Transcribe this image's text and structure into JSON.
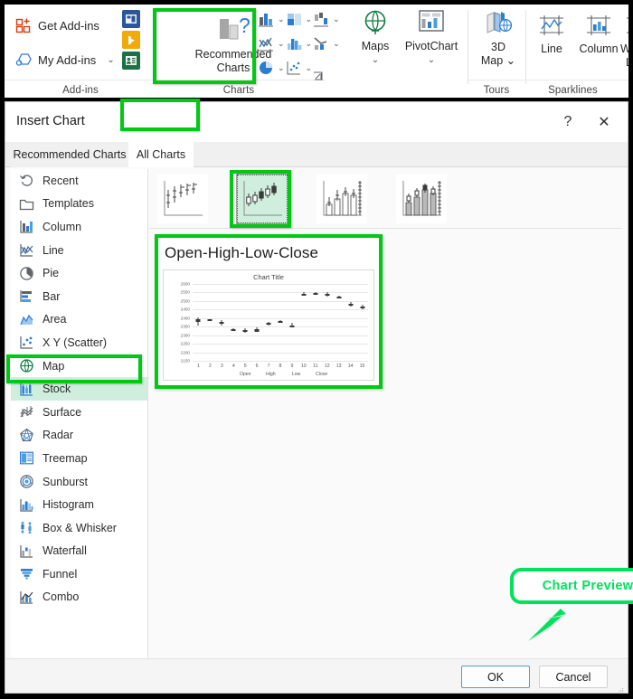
{
  "ribbon": {
    "groups": [
      {
        "name": "Add-ins",
        "caption": "Add-ins"
      },
      {
        "name": "Charts",
        "caption": "Charts"
      },
      {
        "name": "Tours",
        "caption": "Tours"
      },
      {
        "name": "Sparklines",
        "caption": "Sparklines"
      }
    ],
    "addins": {
      "get_addins": "Get Add-ins",
      "my_addins": "My Add-ins",
      "caret": "⌄"
    },
    "recommended_charts": {
      "line1": "Recommended",
      "line2": "Charts"
    },
    "maps": {
      "label": "Maps",
      "caret": "⌄"
    },
    "pivotchart": {
      "label": "PivotChart",
      "caret": "⌄"
    },
    "map3d": {
      "line1": "3D",
      "line2": "Map ⌄"
    },
    "sparklines": [
      {
        "label": "Line"
      },
      {
        "label": "Column"
      },
      {
        "line1": "W",
        "line2": "Lo"
      }
    ],
    "chart_dropdowns": [
      "column-chart-icon",
      "waterfall-chart-icon",
      "stock-chart-icon",
      "line-chart-icon",
      "histogram-chart-icon",
      "combo-chart-icon",
      "pie-chart-icon",
      "scatter-chart-icon"
    ],
    "caret": "⌄"
  },
  "dialog": {
    "title": "Insert Chart",
    "help_glyph": "?",
    "close_glyph": "✕",
    "tabs": [
      {
        "label": "Recommended Charts",
        "selected": false
      },
      {
        "label": "All Charts",
        "selected": true
      }
    ],
    "type_list": [
      {
        "label": "Recent",
        "icon": "recent-icon",
        "selected": false
      },
      {
        "label": "Templates",
        "icon": "templates-icon",
        "selected": false
      },
      {
        "label": "Column",
        "icon": "column-icon",
        "selected": false
      },
      {
        "label": "Line",
        "icon": "line-icon",
        "selected": false
      },
      {
        "label": "Pie",
        "icon": "pie-icon",
        "selected": false
      },
      {
        "label": "Bar",
        "icon": "bar-icon",
        "selected": false
      },
      {
        "label": "Area",
        "icon": "area-icon",
        "selected": false
      },
      {
        "label": "X Y (Scatter)",
        "icon": "scatter-icon",
        "selected": false
      },
      {
        "label": "Map",
        "icon": "map-icon",
        "selected": false
      },
      {
        "label": "Stock",
        "icon": "stock-icon",
        "selected": true
      },
      {
        "label": "Surface",
        "icon": "surface-icon",
        "selected": false
      },
      {
        "label": "Radar",
        "icon": "radar-icon",
        "selected": false
      },
      {
        "label": "Treemap",
        "icon": "treemap-icon",
        "selected": false
      },
      {
        "label": "Sunburst",
        "icon": "sunburst-icon",
        "selected": false
      },
      {
        "label": "Histogram",
        "icon": "histogram-icon",
        "selected": false
      },
      {
        "label": "Box & Whisker",
        "icon": "boxwhisker-icon",
        "selected": false
      },
      {
        "label": "Waterfall",
        "icon": "waterfall-icon",
        "selected": false
      },
      {
        "label": "Funnel",
        "icon": "funnel-icon",
        "selected": false
      },
      {
        "label": "Combo",
        "icon": "combo-icon",
        "selected": false
      }
    ],
    "thumbnails": [
      {
        "name": "high-low-close",
        "selected": false
      },
      {
        "name": "open-high-low-close",
        "selected": true
      },
      {
        "name": "volume-high-low-close",
        "selected": false
      },
      {
        "name": "volume-open-high-low-close",
        "selected": false
      }
    ],
    "preview": {
      "heading": "Open-High-Low-Close"
    },
    "callout": {
      "text": "Chart Preview"
    },
    "footer": {
      "ok": "OK",
      "cancel": "Cancel"
    }
  },
  "chart_data": {
    "type": "line",
    "subtype": "open-high-low-close candlestick",
    "title": "Chart Title",
    "xlabel": "",
    "ylabel": "",
    "ylim": [
      2150,
      2600
    ],
    "ytick_step": 50,
    "yticks": [
      2600,
      2550,
      2500,
      2450,
      2400,
      2350,
      2300,
      2250,
      2200,
      2150
    ],
    "grid": true,
    "legend_position": "bottom",
    "legend": [
      "Open",
      "High",
      "Low",
      "Close"
    ],
    "categories": [
      "1",
      "2",
      "3",
      "4",
      "5",
      "6",
      "7",
      "8",
      "9",
      "10",
      "11",
      "12",
      "13",
      "14",
      "15"
    ],
    "series": [
      {
        "name": "Open",
        "values": [
          2378,
          2388,
          2378,
          2330,
          2328,
          2322,
          2368,
          2382,
          2358,
          2536,
          2545,
          2540,
          2522,
          2485,
          2462
        ]
      },
      {
        "name": "High",
        "values": [
          2402,
          2396,
          2386,
          2340,
          2340,
          2344,
          2380,
          2386,
          2372,
          2552,
          2552,
          2552,
          2530,
          2496,
          2476
        ]
      },
      {
        "name": "Low",
        "values": [
          2358,
          2382,
          2358,
          2326,
          2316,
          2318,
          2358,
          2372,
          2344,
          2530,
          2540,
          2526,
          2516,
          2470,
          2452
        ]
      },
      {
        "name": "Close",
        "values": [
          2392,
          2392,
          2366,
          2334,
          2318,
          2336,
          2372,
          2376,
          2356,
          2540,
          2548,
          2530,
          2526,
          2476,
          2470
        ]
      }
    ]
  }
}
